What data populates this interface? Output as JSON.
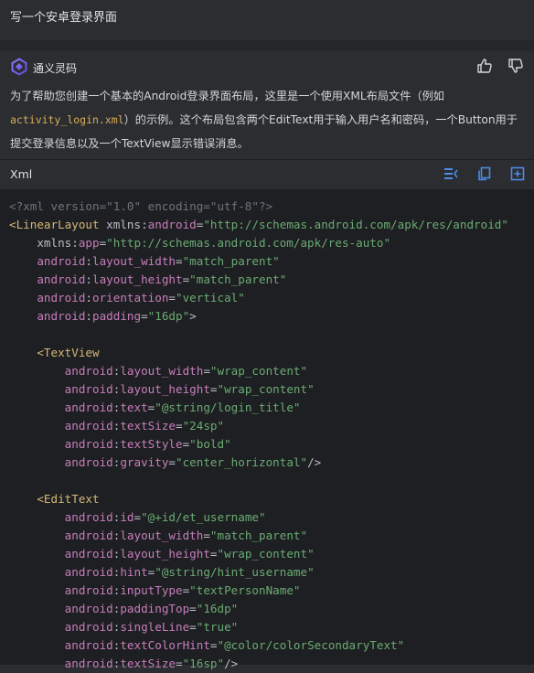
{
  "user_message": "写一个安卓登录界面",
  "assistant": {
    "name": "通义灵码",
    "intro_part1": "为了帮助您创建一个基本的Android登录界面布局，这里是一个使用XML布局文件（例如",
    "intro_code": "activity_login.xml",
    "intro_part2": "）的示例。这个布局包含两个EditText用于输入用户名和密码，一个Button用于提交登录信息以及一个TextView显示错误消息。"
  },
  "code_block": {
    "language": "Xml",
    "lines": [
      [
        [
          "pi",
          "<?xml version=\"1.0\" encoding=\"utf-8\"?>"
        ]
      ],
      [
        [
          "tag",
          "<LinearLayout"
        ],
        [
          "attr",
          " xmlns:"
        ],
        [
          "ns",
          "android"
        ],
        [
          "attr",
          "="
        ],
        [
          "str",
          "\"http://schemas.android.com/apk/res/android\""
        ]
      ],
      [
        [
          "attr",
          "    xmlns:"
        ],
        [
          "ns",
          "app"
        ],
        [
          "attr",
          "="
        ],
        [
          "str",
          "\"http://schemas.android.com/apk/res-auto\""
        ]
      ],
      [
        [
          "ns",
          "    android"
        ],
        [
          "attr",
          ":"
        ],
        [
          "ns",
          "layout_width"
        ],
        [
          "attr",
          "="
        ],
        [
          "str",
          "\"match_parent\""
        ]
      ],
      [
        [
          "ns",
          "    android"
        ],
        [
          "attr",
          ":"
        ],
        [
          "ns",
          "layout_height"
        ],
        [
          "attr",
          "="
        ],
        [
          "str",
          "\"match_parent\""
        ]
      ],
      [
        [
          "ns",
          "    android"
        ],
        [
          "attr",
          ":"
        ],
        [
          "ns",
          "orientation"
        ],
        [
          "attr",
          "="
        ],
        [
          "str",
          "\"vertical\""
        ]
      ],
      [
        [
          "ns",
          "    android"
        ],
        [
          "attr",
          ":"
        ],
        [
          "ns",
          "padding"
        ],
        [
          "attr",
          "="
        ],
        [
          "str",
          "\"16dp\""
        ],
        [
          "punc",
          ">"
        ]
      ],
      [
        [
          "attr",
          ""
        ]
      ],
      [
        [
          "tag",
          "    <TextView"
        ]
      ],
      [
        [
          "ns",
          "        android"
        ],
        [
          "attr",
          ":"
        ],
        [
          "ns",
          "layout_width"
        ],
        [
          "attr",
          "="
        ],
        [
          "str",
          "\"wrap_content\""
        ]
      ],
      [
        [
          "ns",
          "        android"
        ],
        [
          "attr",
          ":"
        ],
        [
          "ns",
          "layout_height"
        ],
        [
          "attr",
          "="
        ],
        [
          "str",
          "\"wrap_content\""
        ]
      ],
      [
        [
          "ns",
          "        android"
        ],
        [
          "attr",
          ":"
        ],
        [
          "ns",
          "text"
        ],
        [
          "attr",
          "="
        ],
        [
          "str",
          "\"@string/login_title\""
        ]
      ],
      [
        [
          "ns",
          "        android"
        ],
        [
          "attr",
          ":"
        ],
        [
          "ns",
          "textSize"
        ],
        [
          "attr",
          "="
        ],
        [
          "str",
          "\"24sp\""
        ]
      ],
      [
        [
          "ns",
          "        android"
        ],
        [
          "attr",
          ":"
        ],
        [
          "ns",
          "textStyle"
        ],
        [
          "attr",
          "="
        ],
        [
          "str",
          "\"bold\""
        ]
      ],
      [
        [
          "ns",
          "        android"
        ],
        [
          "attr",
          ":"
        ],
        [
          "ns",
          "gravity"
        ],
        [
          "attr",
          "="
        ],
        [
          "str",
          "\"center_horizontal\""
        ],
        [
          "punc",
          "/>"
        ]
      ],
      [
        [
          "attr",
          ""
        ]
      ],
      [
        [
          "tag",
          "    <EditText"
        ]
      ],
      [
        [
          "ns",
          "        android"
        ],
        [
          "attr",
          ":"
        ],
        [
          "ns",
          "id"
        ],
        [
          "attr",
          "="
        ],
        [
          "str",
          "\"@+id/et_username\""
        ]
      ],
      [
        [
          "ns",
          "        android"
        ],
        [
          "attr",
          ":"
        ],
        [
          "ns",
          "layout_width"
        ],
        [
          "attr",
          "="
        ],
        [
          "str",
          "\"match_parent\""
        ]
      ],
      [
        [
          "ns",
          "        android"
        ],
        [
          "attr",
          ":"
        ],
        [
          "ns",
          "layout_height"
        ],
        [
          "attr",
          "="
        ],
        [
          "str",
          "\"wrap_content\""
        ]
      ],
      [
        [
          "ns",
          "        android"
        ],
        [
          "attr",
          ":"
        ],
        [
          "ns",
          "hint"
        ],
        [
          "attr",
          "="
        ],
        [
          "str",
          "\"@string/hint_username\""
        ]
      ],
      [
        [
          "ns",
          "        android"
        ],
        [
          "attr",
          ":"
        ],
        [
          "ns",
          "inputType"
        ],
        [
          "attr",
          "="
        ],
        [
          "str",
          "\"textPersonName\""
        ]
      ],
      [
        [
          "ns",
          "        android"
        ],
        [
          "attr",
          ":"
        ],
        [
          "ns",
          "paddingTop"
        ],
        [
          "attr",
          "="
        ],
        [
          "str",
          "\"16dp\""
        ]
      ],
      [
        [
          "ns",
          "        android"
        ],
        [
          "attr",
          ":"
        ],
        [
          "ns",
          "singleLine"
        ],
        [
          "attr",
          "="
        ],
        [
          "str",
          "\"true\""
        ]
      ],
      [
        [
          "ns",
          "        android"
        ],
        [
          "attr",
          ":"
        ],
        [
          "ns",
          "textColorHint"
        ],
        [
          "attr",
          "="
        ],
        [
          "str",
          "\"@color/colorSecondaryText\""
        ]
      ],
      [
        [
          "ns",
          "        android"
        ],
        [
          "attr",
          ":"
        ],
        [
          "ns",
          "textSize"
        ],
        [
          "attr",
          "="
        ],
        [
          "str",
          "\"16sp\""
        ],
        [
          "punc",
          "/>"
        ]
      ]
    ]
  },
  "icons": {
    "logo": "tongyi-logo-icon",
    "like": "thumbs-up-icon",
    "dislike": "thumbs-down-icon",
    "insert": "insert-code-icon",
    "copy": "copy-icon",
    "new_file": "new-file-icon"
  },
  "colors": {
    "background": "#2b2d30",
    "code_background": "#1e1f22",
    "accent": "#4e8be8"
  }
}
